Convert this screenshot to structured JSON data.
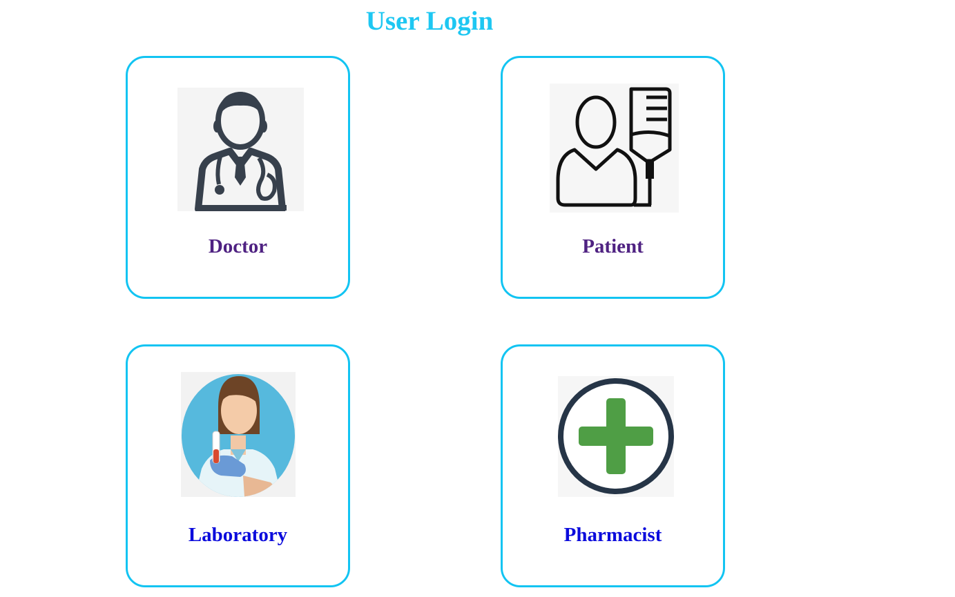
{
  "page": {
    "title": "User Login"
  },
  "cards": [
    {
      "label": "Doctor",
      "icon": "doctor-icon"
    },
    {
      "label": "Patient",
      "icon": "patient-iv-icon"
    },
    {
      "label": "Laboratory",
      "icon": "lab-technician-icon"
    },
    {
      "label": "Pharmacist",
      "icon": "medical-cross-icon"
    }
  ],
  "colors": {
    "title": "#1ec7f2",
    "card_border": "#12c4f2",
    "label_visited": "#4f2282",
    "label_link": "#0b0bdc"
  }
}
